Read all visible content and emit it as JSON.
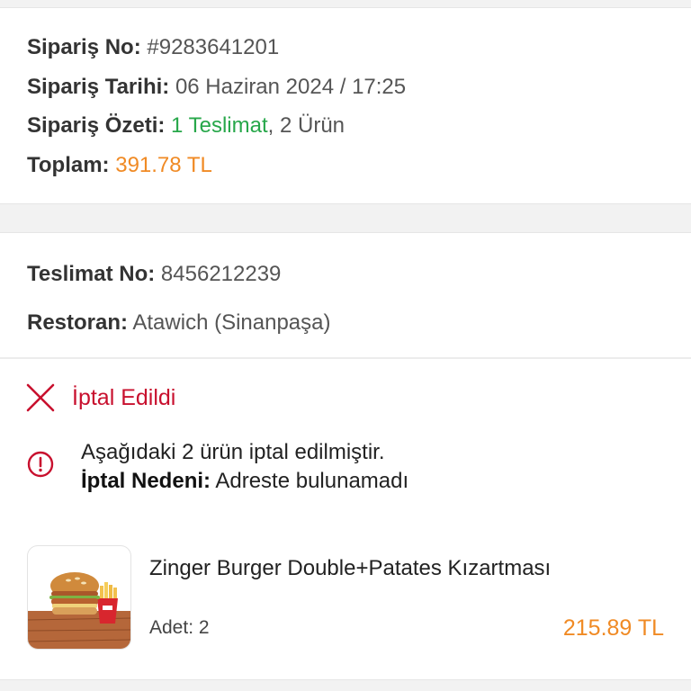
{
  "order": {
    "no_label": "Sipariş No:",
    "no_value": "#9283641201",
    "date_label": "Sipariş Tarihi:",
    "date_value": "06 Haziran 2024 / 17:25",
    "summary_label": "Sipariş Özeti:",
    "summary_delivery": "1 Teslimat",
    "summary_sep": ",",
    "summary_items": " 2 Ürün",
    "total_label": "Toplam:",
    "total_value": "391.78 TL"
  },
  "delivery": {
    "no_label": "Teslimat No:",
    "no_value": "8456212239",
    "restaurant_label": "Restoran:",
    "restaurant_value": "Atawich (Sinanpaşa)",
    "status": "İptal Edildi",
    "cancel_message": "Aşağıdaki 2 ürün iptal edilmiştir.",
    "reason_label": "İptal Nedeni:",
    "reason_value": " Adreste bulunamadı"
  },
  "product": {
    "name": "Zinger Burger Double+Patates Kızartması",
    "qty_label": "Adet:",
    "qty_value": "2",
    "price": "215.89 TL"
  },
  "colors": {
    "accent_orange": "#f08a24",
    "success_green": "#27a74a",
    "cancel_red": "#c8102e"
  },
  "icons": {
    "status": "close-x-icon",
    "info": "info-circle-icon",
    "product_image": "burger-fries-image"
  }
}
